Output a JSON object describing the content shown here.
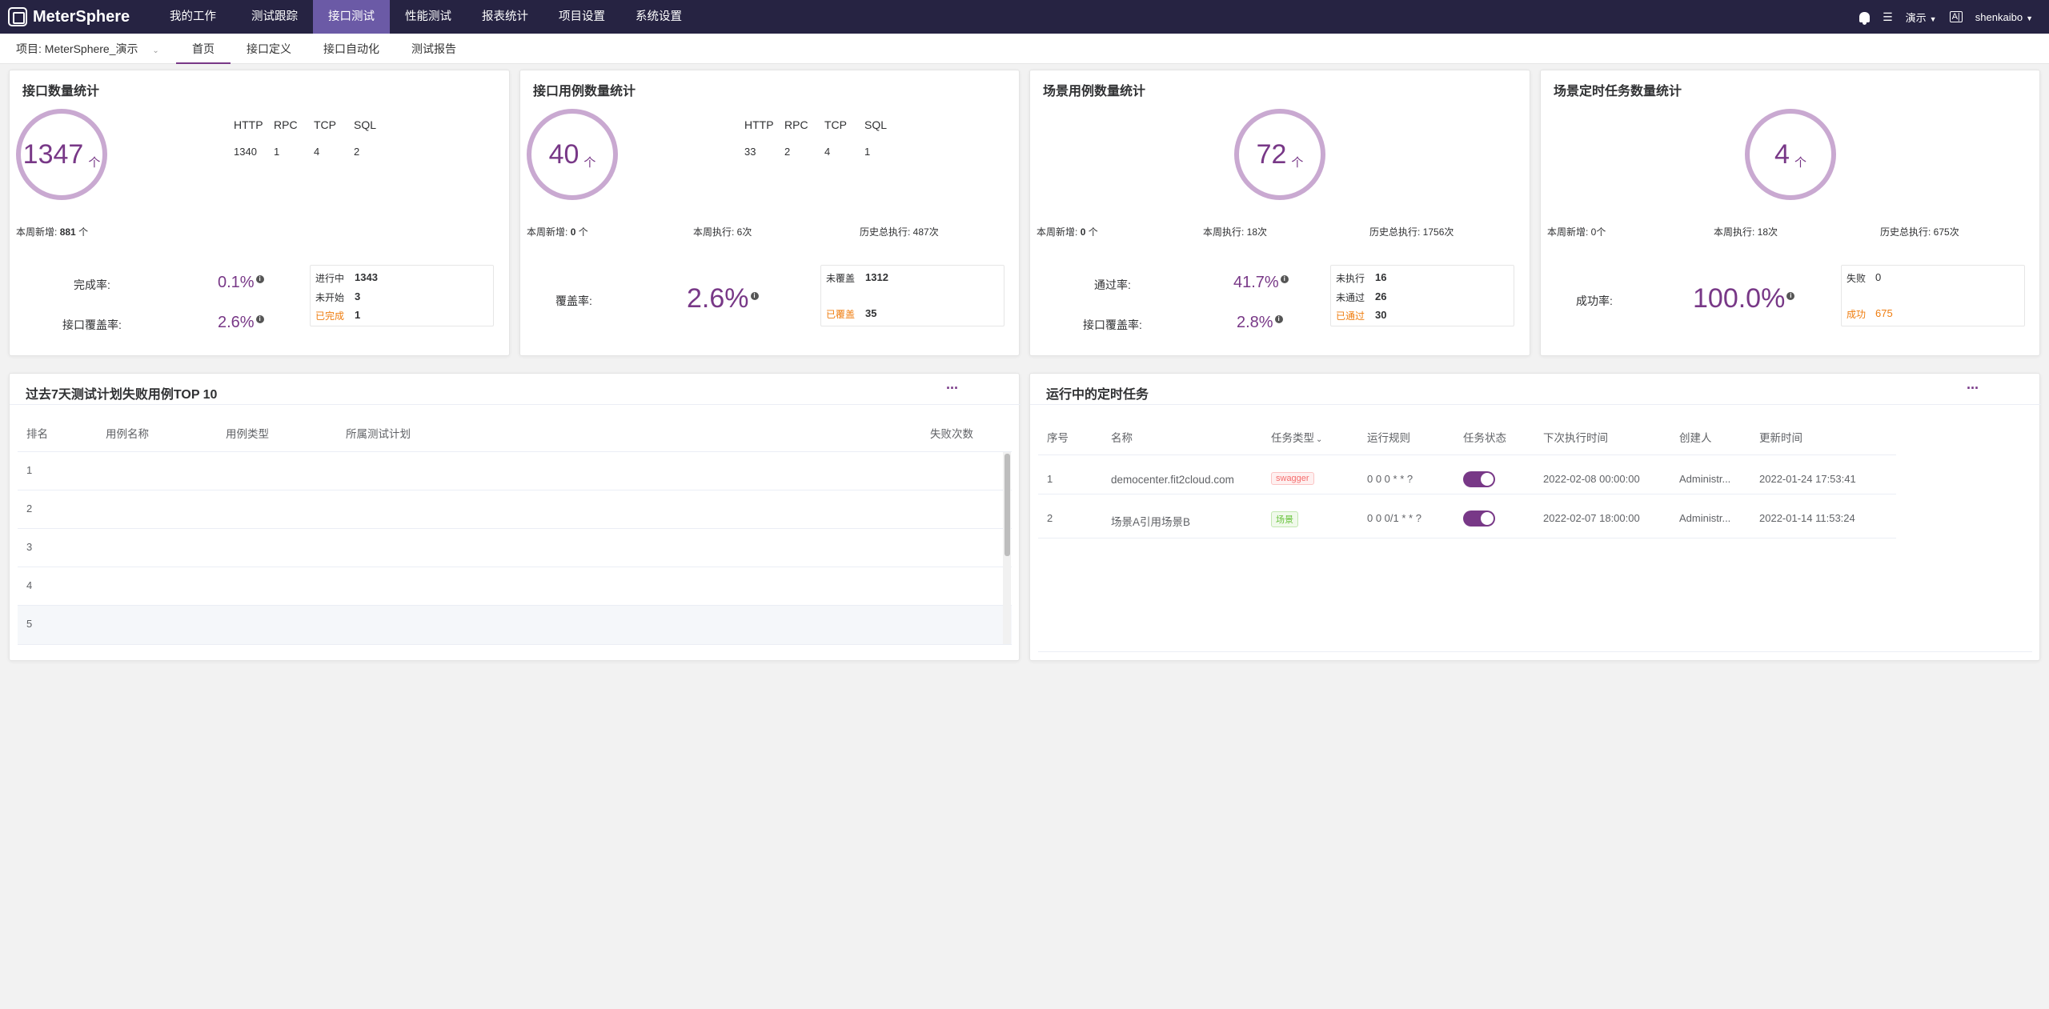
{
  "colors": {
    "nav_bg": "#262342",
    "nav_active": "#6b5aa6",
    "accent": "#783887",
    "ring": "#c9a9d1",
    "orange": "#ef7d0f"
  },
  "topbar": {
    "logo": "MeterSphere",
    "nav": [
      "我的工作台",
      "测试跟踪",
      "接口测试",
      "性能测试",
      "报表统计",
      "项目设置",
      "系统设置"
    ],
    "active_nav": "接口测试",
    "right": {
      "workspace": "演示",
      "user": "shenkaibo"
    }
  },
  "subbar": {
    "project": "项目: MeterSphere_演示",
    "tabs": [
      "首页",
      "接口定义",
      "接口自动化",
      "测试报告"
    ],
    "active_tab": "首页"
  },
  "cards": {
    "api_count": {
      "title": "接口数量统计",
      "total": "1347",
      "arrow": "个",
      "types": {
        "headers": [
          "HTTP",
          "RPC",
          "TCP",
          "SQL"
        ],
        "values": [
          "1340",
          "1",
          "4",
          "2"
        ]
      },
      "week_new_label": "本周新增:",
      "week_new_value": "881",
      "week_new_unit": "个",
      "rate1_label": "完成率:",
      "rate1_value": "0.1%",
      "rate2_label": "接口覆盖率:",
      "rate2_value": "2.6%",
      "status": [
        {
          "label": "进行中",
          "value": "1343"
        },
        {
          "label": "未开始",
          "value": "3"
        },
        {
          "label": "已完成",
          "value": "1"
        }
      ]
    },
    "case_count": {
      "title": "接口用例数量统计",
      "total": "40",
      "arrow": "个",
      "types": {
        "headers": [
          "HTTP",
          "RPC",
          "TCP",
          "SQL"
        ],
        "values": [
          "33",
          "2",
          "4",
          "1"
        ]
      },
      "week_new_label": "本周新增:",
      "week_new_value": "0",
      "week_new_unit": "个",
      "week_exec": "本周执行: 6次",
      "history_exec": "历史总执行: 487次",
      "rate_label": "覆盖率:",
      "rate_value": "2.6%",
      "status": [
        {
          "label": "未覆盖",
          "value": "1312"
        },
        {
          "label": "已覆盖",
          "value": "35"
        }
      ]
    },
    "scenario_count": {
      "title": "场景用例数量统计",
      "total": "72",
      "arrow": "个",
      "week_new_label": "本周新增:",
      "week_new_value": "0",
      "week_new_unit": "个",
      "week_exec": "本周执行: 18次",
      "history_exec": "历史总执行: 1756次",
      "rate1_label": "通过率:",
      "rate1_value": "41.7%",
      "rate2_label": "接口覆盖率:",
      "rate2_value": "2.8%",
      "status": [
        {
          "label": "未执行",
          "value": "16"
        },
        {
          "label": "未通过",
          "value": "26"
        },
        {
          "label": "已通过",
          "value": "30"
        }
      ]
    },
    "schedule_count": {
      "title": "场景定时任务数量统计",
      "total": "4",
      "arrow": "个",
      "week_new": "本周新增: 0个",
      "week_exec": "本周执行: 18次",
      "history_exec": "历史总执行: 675次",
      "rate_label": "成功率:",
      "rate_value": "100.0%",
      "status": [
        {
          "label": "失败",
          "value": "0"
        },
        {
          "label": "成功",
          "value": "675"
        }
      ]
    }
  },
  "failure_top": {
    "title": "过去7天测试计划失败用例TOP 10",
    "more": "···",
    "headers": [
      "排名",
      "用例名称",
      "用例类型",
      "所属测试计划",
      "失败次数"
    ],
    "rows": [
      {
        "rank": "1"
      },
      {
        "rank": "2"
      },
      {
        "rank": "3"
      },
      {
        "rank": "4"
      },
      {
        "rank": "5"
      }
    ]
  },
  "running_tasks": {
    "title": "运行中的定时任务",
    "more": "···",
    "headers": [
      "序号",
      "名称",
      "任务类型",
      "运行规则",
      "任务状态",
      "下次执行时间",
      "创建人",
      "更新时间"
    ],
    "sort_icon": "⌄",
    "rows": [
      {
        "no": "1",
        "name": "democenter.fit2cloud.com",
        "type": "swagger",
        "rule": "0 0 0 * * ?",
        "enabled": true,
        "next": "2022-02-08 00:00:00",
        "creator": "Administr...",
        "updated": "2022-01-24 17:53:41"
      },
      {
        "no": "2",
        "name": "场景A引用场景B",
        "type": "场景",
        "rule": "0 0 0/1 * * ?",
        "enabled": true,
        "next": "2022-02-07 18:00:00",
        "creator": "Administr...",
        "updated": "2022-01-14 11:53:24"
      }
    ]
  }
}
